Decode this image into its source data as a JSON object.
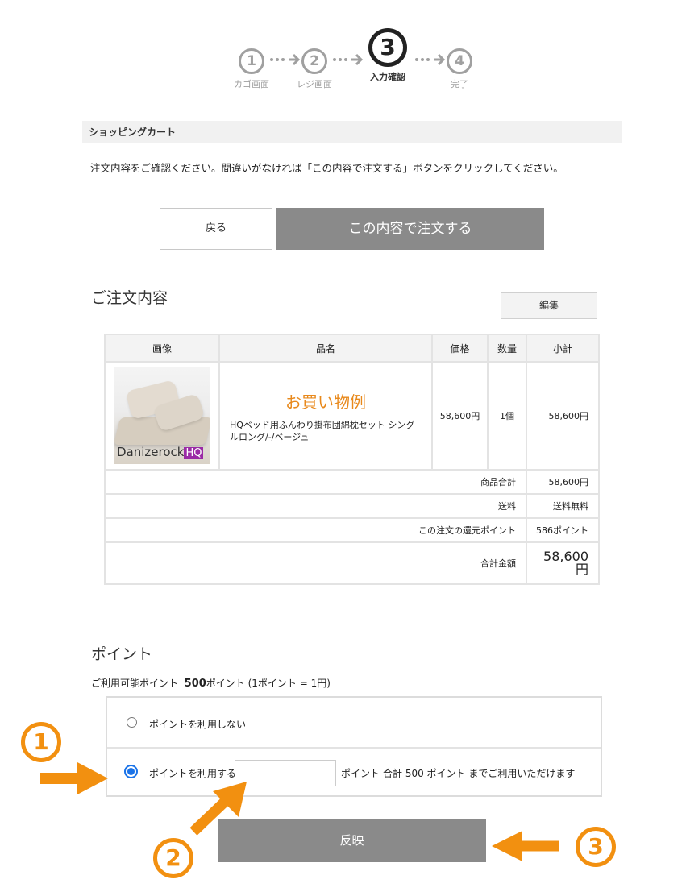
{
  "stepper": [
    {
      "num": "1",
      "label": "カゴ画面"
    },
    {
      "num": "2",
      "label": "レジ画面"
    },
    {
      "num": "3",
      "label": "入力確認"
    },
    {
      "num": "4",
      "label": "完了"
    }
  ],
  "section_title": "ショッピングカート",
  "notice": "注文内容をご確認ください。間違いがなければ「この内容で注文する」ボタンをクリックしてください。",
  "buttons": {
    "back": "戻る",
    "order": "この内容で注文する",
    "edit": "編集",
    "apply": "反映"
  },
  "order_heading": "ご注文内容",
  "cart": {
    "headers": [
      "画像",
      "品名",
      "価格",
      "数量",
      "小計"
    ],
    "item": {
      "image_brand": "Danizerock",
      "image_brand_hq": "HQ",
      "example_label": "お買い物例",
      "name": "HQベッド用ふんわり掛布団綿枕セット シングルロング/-/ベージュ",
      "price": "58,600円",
      "qty": "1個",
      "subtotal": "58,600円"
    },
    "summary": [
      {
        "label": "商品合計",
        "value": "58,600円"
      },
      {
        "label": "送料",
        "value": "送料無料"
      },
      {
        "label": "この注文の還元ポイント",
        "value": "586ポイント"
      }
    ],
    "total_label": "合計金額",
    "total_value_num": "58,600",
    "total_value_unit": "円"
  },
  "points": {
    "heading": "ポイント",
    "available_prefix": "ご利用可能ポイント",
    "available_value": "500",
    "available_suffix": "ポイント (1ポイント = 1円)",
    "option_no": "ポイントを利用しない",
    "option_yes": "ポイントを利用する",
    "input_value": "",
    "input_unit": "ポイント",
    "hint": "合計 500 ポイント までご利用いただけます",
    "selected": "yes"
  },
  "callouts": [
    "1",
    "2",
    "3"
  ],
  "colors": {
    "accent_orange": "#f29010",
    "button_gray": "#8a8a8a",
    "radio_blue": "#1a73e8"
  }
}
